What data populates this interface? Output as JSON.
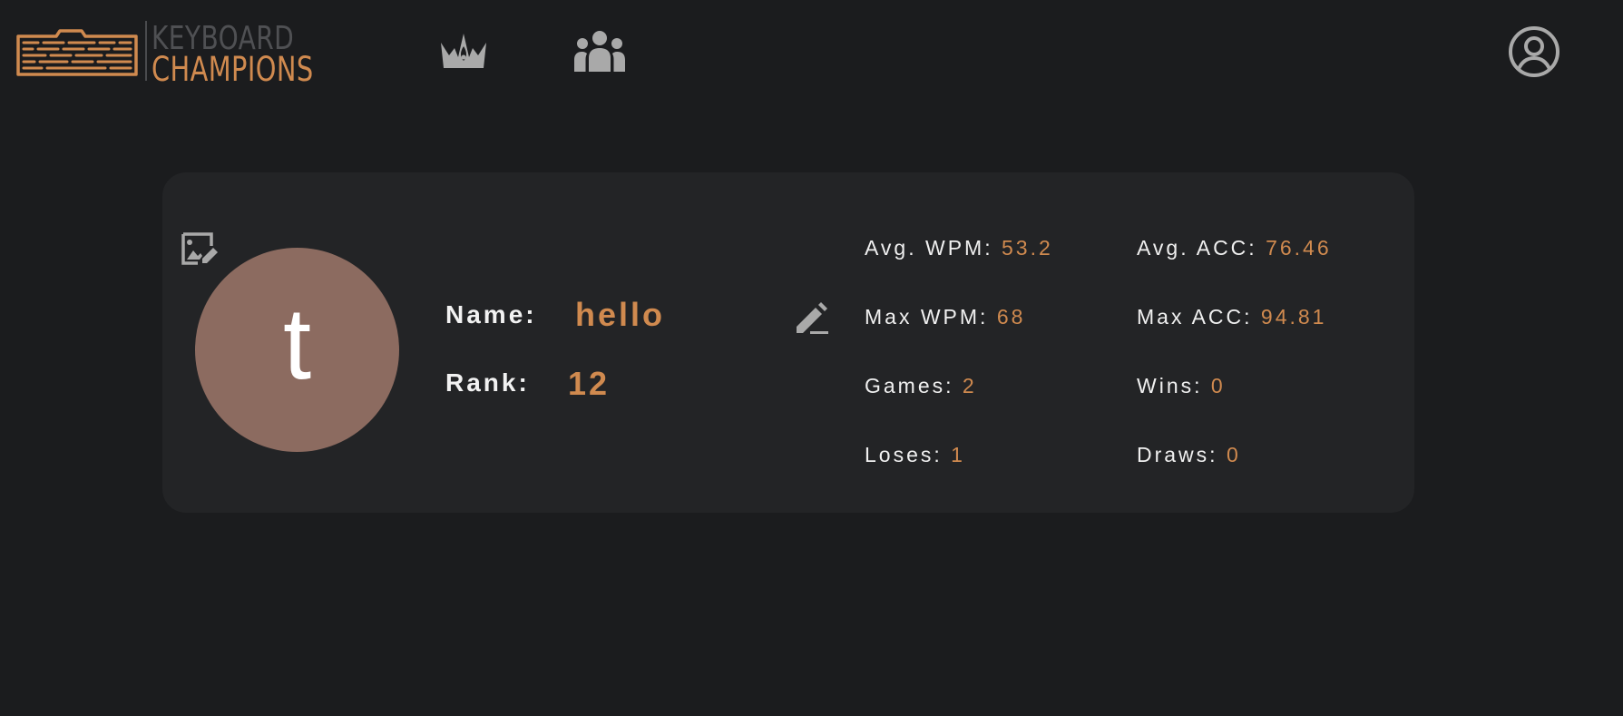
{
  "header": {
    "brand_line1": "KEYBOARD",
    "brand_line2": "CHAMPIONS",
    "nav": [
      {
        "icon": "crown-icon",
        "name": "leaderboard"
      },
      {
        "icon": "friends-icon",
        "name": "friends"
      }
    ],
    "profile_icon": "account-circle-icon"
  },
  "profile": {
    "avatar_letter": "t",
    "avatar_color": "#8c6b60",
    "name_label": "Name:",
    "name_value": "hello",
    "rank_label": "Rank:",
    "rank_value": "12",
    "stats": [
      {
        "label": "Avg. WPM:",
        "value": "53.2"
      },
      {
        "label": "Avg. ACC:",
        "value": "76.46"
      },
      {
        "label": "Max WPM:",
        "value": "68"
      },
      {
        "label": "Max ACC:",
        "value": "94.81"
      },
      {
        "label": "Games:",
        "value": "2"
      },
      {
        "label": "Wins:",
        "value": "0"
      },
      {
        "label": "Loses:",
        "value": "1"
      },
      {
        "label": "Draws:",
        "value": "0"
      }
    ]
  },
  "colors": {
    "accent": "#d08a4f",
    "background": "#1b1c1e",
    "card": "#232426",
    "icon_gray": "#a9a9a9"
  }
}
